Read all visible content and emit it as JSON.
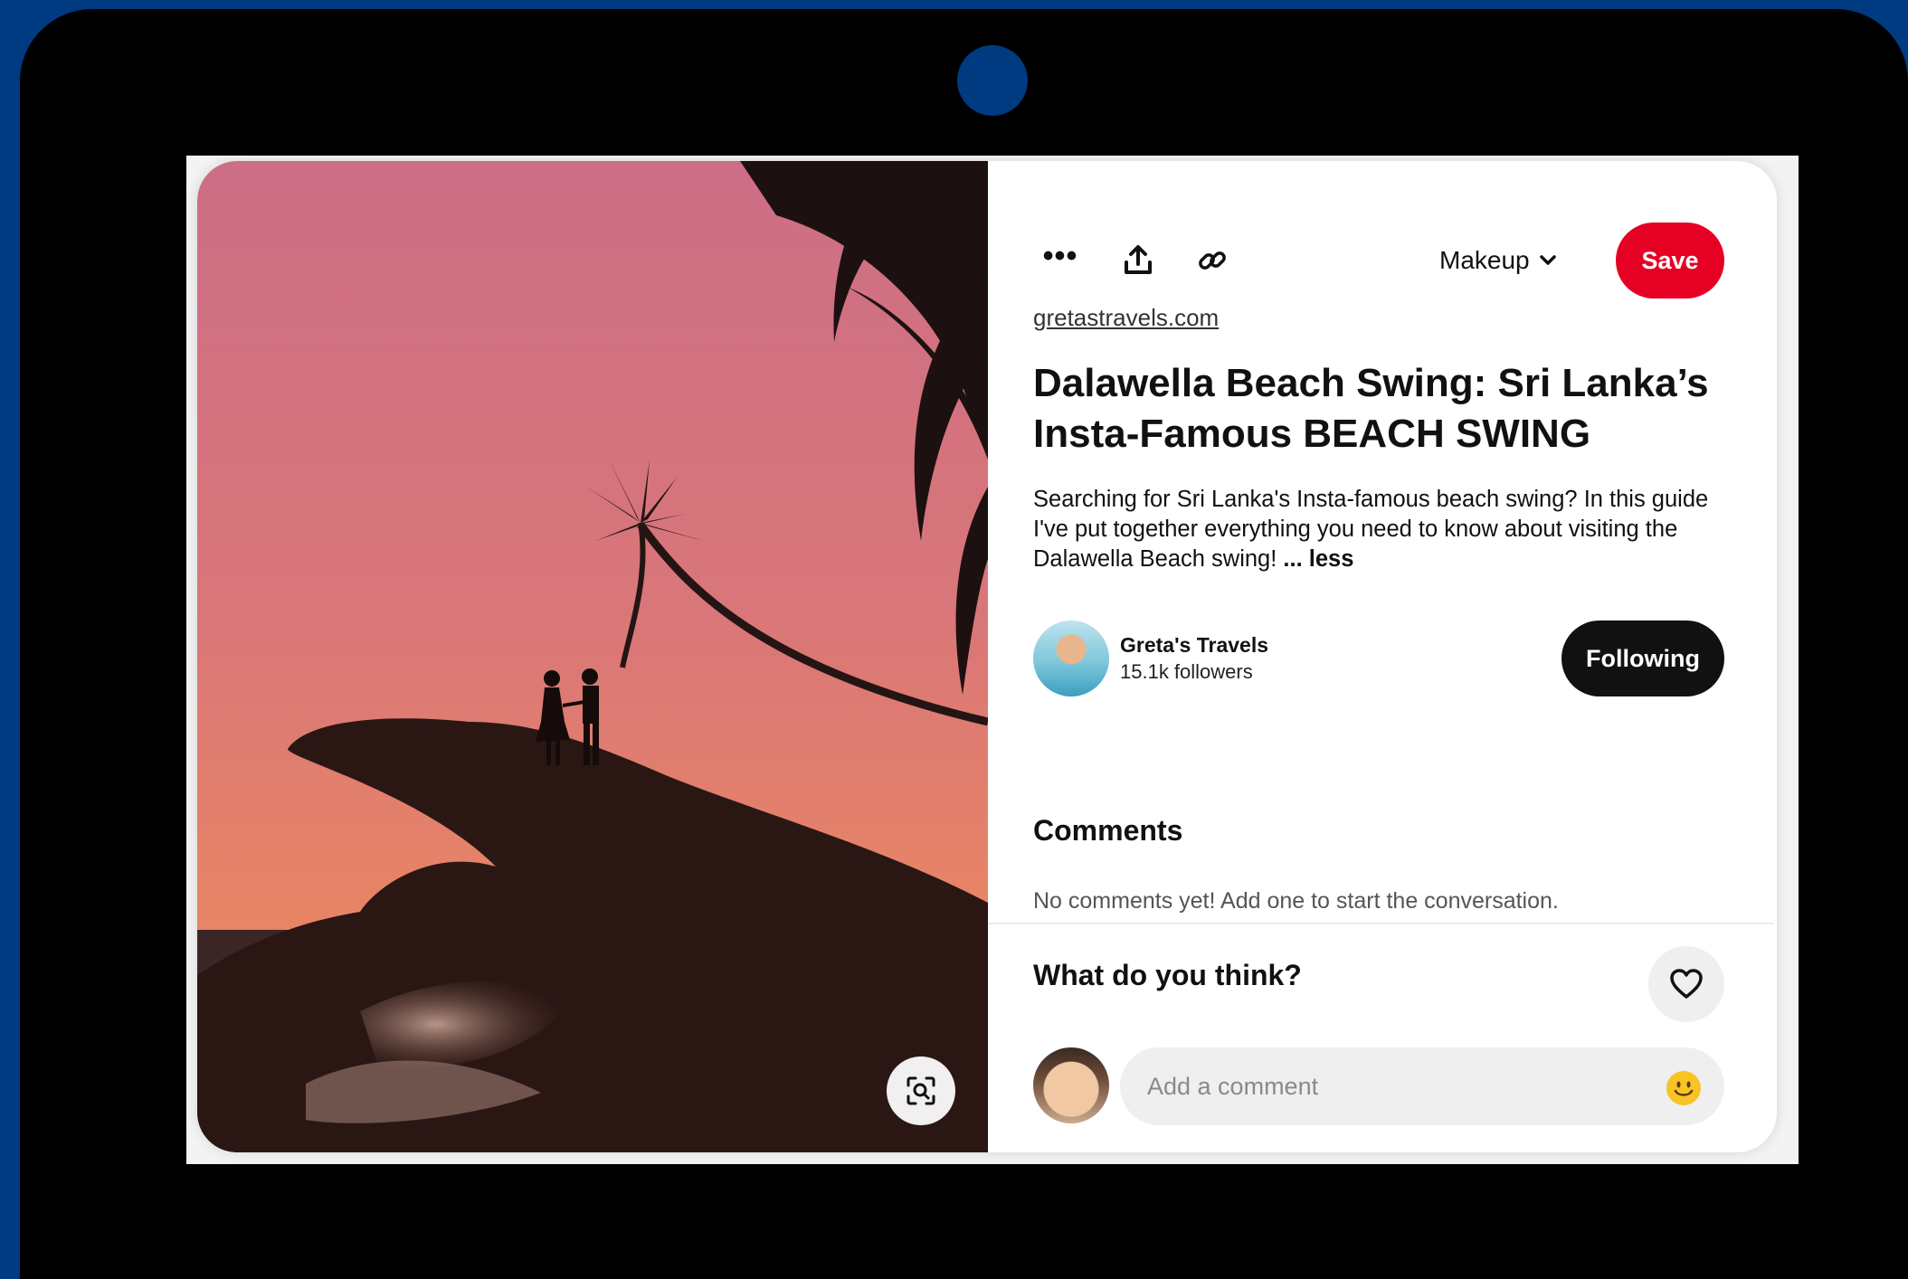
{
  "theme": {
    "frame_bg": "#003a80",
    "save_color": "#e60023",
    "follow_color": "#111111"
  },
  "toolbar": {
    "more_icon": "more-dots-icon",
    "share_icon": "share-upload-icon",
    "link_icon": "link-icon",
    "board_name": "Makeup",
    "save_label": "Save"
  },
  "pin": {
    "source_link": "gretastravels.com",
    "title": "Dalawella Beach Swing: Sri Lanka’s Insta-Famous BEACH SWING",
    "description": "Searching for Sri Lanka's Insta-famous beach swing? In this guide I've put together everything you need to know about visiting the Dalawella Beach swing!",
    "less_label": "... less",
    "image_lens_icon": "visual-search-icon"
  },
  "creator": {
    "name": "Greta's Travels",
    "followers": "15.1k followers",
    "follow_label": "Following"
  },
  "comments": {
    "heading": "Comments",
    "empty_text": "No comments yet! Add one to start the conversation.",
    "prompt": "What do you think?",
    "react_icon": "heart-icon",
    "input_placeholder": "Add a comment",
    "emoji_icon": "smiley-emoji-icon"
  }
}
